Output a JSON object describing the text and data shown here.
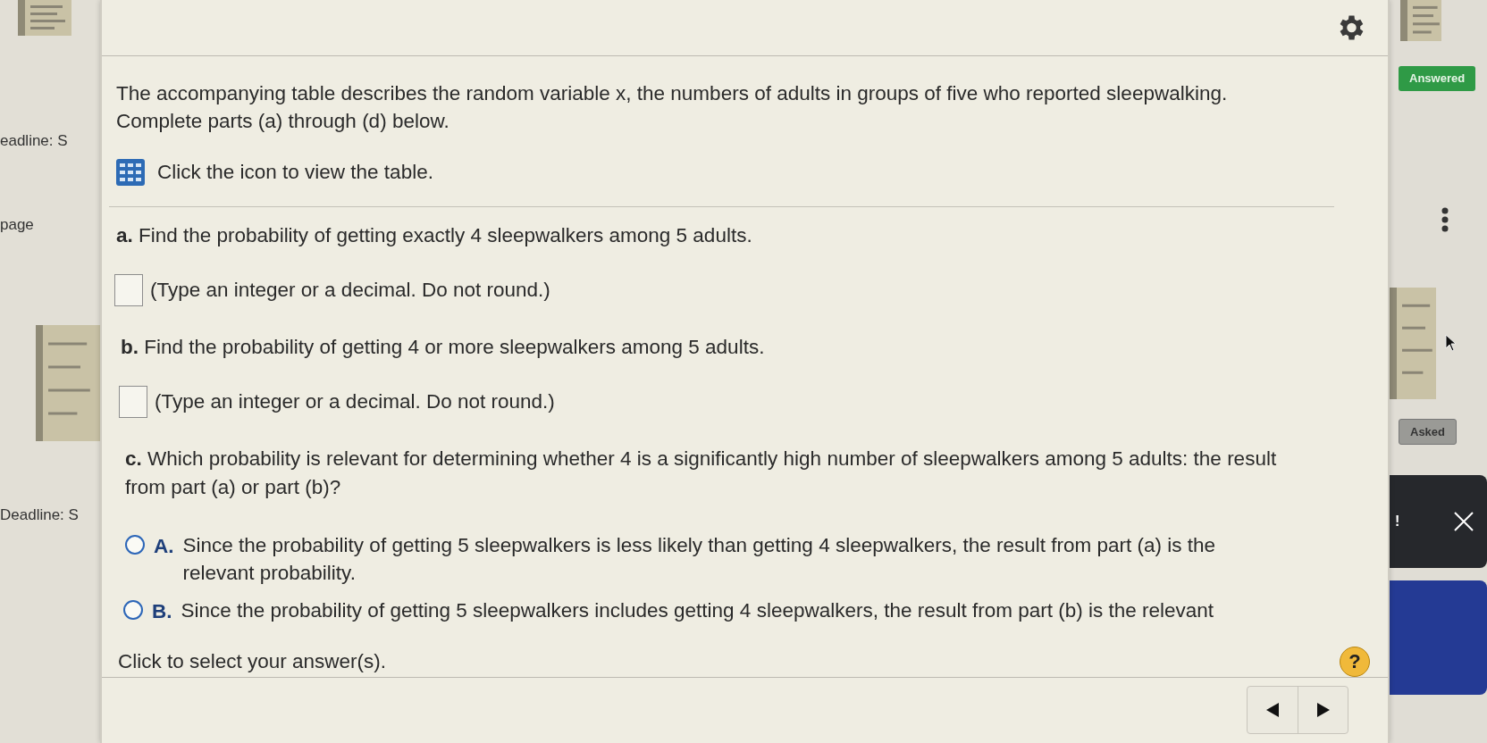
{
  "left_strip": {
    "labels": [
      "eadline: S",
      "page",
      "Deadline: S"
    ]
  },
  "dialog": {
    "intro": "The accompanying table describes the random variable x, the numbers of adults in groups of five who reported sleepwalking.\nComplete parts (a) through (d) below.",
    "table_link": "Click the icon to view the table.",
    "parts": [
      {
        "kind": "input",
        "question": "**a.** Find the probability of getting exactly 4 sleepwalkers among 5 adults.",
        "hint": "(Type an integer or a decimal. Do not round.)"
      },
      {
        "kind": "input",
        "question": "**b.** Find the probability of getting 4 or more sleepwalkers among 5 adults.",
        "hint": "(Type an integer or a decimal. Do not round.)"
      },
      {
        "kind": "choice",
        "question": "**c.** Which probability is relevant for determining whether 4 is a significantly high number of sleepwalkers among 5 adults: the result\nfrom part (a) or part (b)?",
        "options": [
          {
            "letter": "A.",
            "text": "Since the probability of getting 5 sleepwalkers is less likely than getting 4 sleepwalkers, the result from part (a) is the\nrelevant probability.",
            "selected": false
          },
          {
            "letter": "B.",
            "text": "Since the probability of getting 5 sleepwalkers includes getting 4 sleepwalkers, the result from part (b) is the relevant",
            "selected": false
          }
        ]
      }
    ],
    "footer": "Click to select your answer(s).",
    "help": "?"
  },
  "right_strip": {
    "badges": [
      {
        "text": "Answered",
        "kind": "answered"
      },
      {
        "text": "Asked",
        "kind": "asked"
      }
    ],
    "alert": "!"
  }
}
